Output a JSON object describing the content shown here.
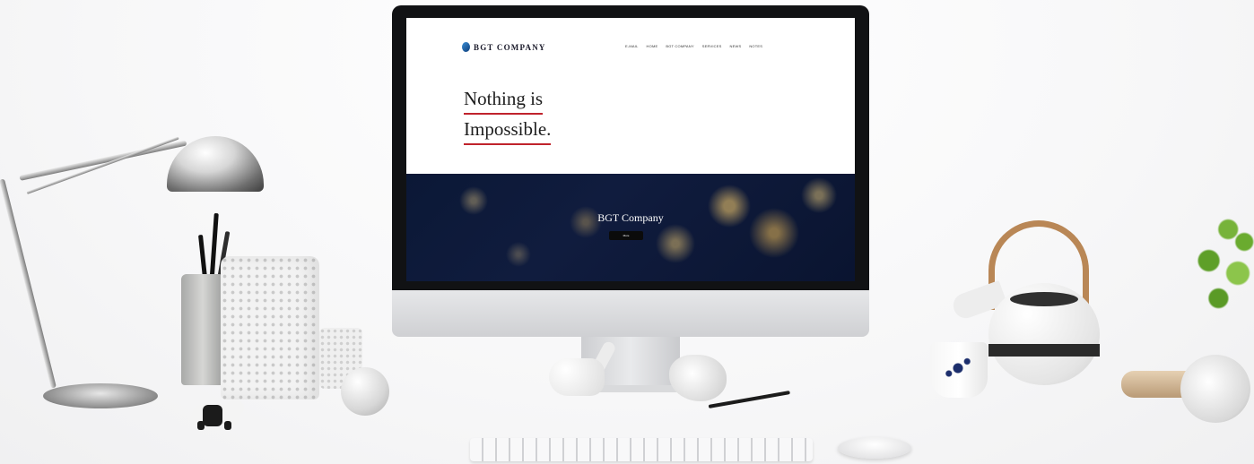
{
  "site": {
    "logo_text": "BGT COMPANY",
    "nav": [
      "E-MAIL",
      "HOME",
      "BGT COMPANY",
      "SERVICES",
      "NEWS",
      "NOTES"
    ],
    "hero_lines": [
      "Nothing is",
      "Impossible."
    ],
    "banner_title": "BGT Company",
    "banner_button": "More"
  },
  "colors": {
    "accent_underline": "#c0232c",
    "banner_night": "#0b1836",
    "city_lights": "#ffd070",
    "bezel": "#111214",
    "logo_blue": "#1f5fa8"
  },
  "icons": [
    "logo-mark-icon"
  ]
}
